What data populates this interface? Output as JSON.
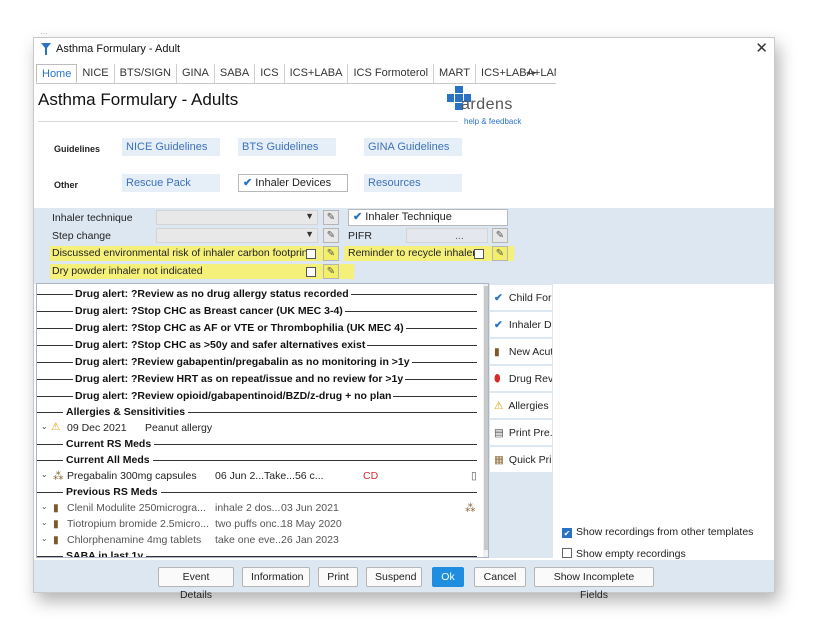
{
  "ghost_text": "...",
  "window": {
    "title": "Asthma Formulary - Adult"
  },
  "tabs": [
    "Home",
    "NICE",
    "BTS/SIGN",
    "GINA",
    "SABA",
    "ICS",
    "ICS+LABA",
    "ICS Formoterol",
    "MART",
    "ICS+LABA+LAMA"
  ],
  "tab_scroll": "◂ ▸",
  "heading": "Asthma Formulary - Adults",
  "logo": {
    "name": "ardens",
    "sub": "help & feedback"
  },
  "guidelines": {
    "label": "Guidelines",
    "nice": "NICE Guidelines",
    "bts": "BTS Guidelines",
    "gina": "GINA Guidelines"
  },
  "other": {
    "label": "Other",
    "rescue": "Rescue Pack",
    "inhaler_devices": "Inhaler Devices",
    "resources": "Resources"
  },
  "form": {
    "inhaler_technique": "Inhaler technique",
    "step_change": "Step change",
    "inhaler_technique_btn": "Inhaler Technique",
    "pifr": "PIFR",
    "pifr_dots": "...",
    "discussed_env": "Discussed environmental risk of inhaler carbon footprint",
    "reminder_recycle": "Reminder to recycle inhaler",
    "dry_powder": "Dry powder inhaler not indicated"
  },
  "alerts": [
    "Drug alert: ?Review as no drug allergy status recorded",
    "Drug alert: ?Stop CHC as Breast cancer (UK MEC 3-4)",
    "Drug alert: ?Stop CHC as AF or VTE or Thrombophilia (UK MEC 4)",
    "Drug alert: ?Stop CHC as >50y and safer alternatives exist",
    "Drug alert: ?Review gabapentin/pregabalin as no monitoring in >1y",
    "Drug alert: ?Review HRT as on repeat/issue and no review for >1y",
    "Drug alert: ?Review opioid/gabapentinoid/BZD/z-drug + no plan"
  ],
  "sections": {
    "allergies": "Allergies & Sensitivities",
    "current_rs": "Current RS Meds",
    "current_all": "Current All Meds",
    "previous_rs": "Previous RS Meds",
    "saba": "SABA in last 1y"
  },
  "allergy_row": {
    "date": "09 Dec 2021",
    "text": "Peanut allergy"
  },
  "current_med": {
    "name": "Pregabalin 300mg capsules",
    "detail": "06 Jun 2...Take...56 c...",
    "flag": "CD"
  },
  "previous_meds": [
    {
      "name": "Clenil Modulite 250microgra...",
      "detail": "inhale 2 dos...",
      "date": "03 Jun 2021"
    },
    {
      "name": "Tiotropium bromide 2.5micro...",
      "detail": "two puffs onc...",
      "date": "18 May 2020"
    },
    {
      "name": "Chlorphenamine 4mg tablets",
      "detail": "take one eve...",
      "date": "26 Jan 2023"
    }
  ],
  "side_actions": [
    "Child Form...",
    "Inhaler Dev...",
    "New Acute...",
    "Drug Revi...",
    "Allergies",
    "Print Pre...",
    "Quick Pri..."
  ],
  "options": {
    "show_other": "Show recordings from other templates",
    "show_empty": "Show empty recordings"
  },
  "buttons": {
    "event_details": "Event Details",
    "information": "Information",
    "print": "Print",
    "suspend": "Suspend",
    "ok": "Ok",
    "cancel": "Cancel",
    "show_incomplete": "Show Incomplete Fields"
  },
  "colors": {
    "accent": "#2a73c4",
    "panel": "#dde7f2",
    "highlight": "#f4f07a",
    "ok": "#1f8de0",
    "cd_red": "#d22c2c"
  }
}
